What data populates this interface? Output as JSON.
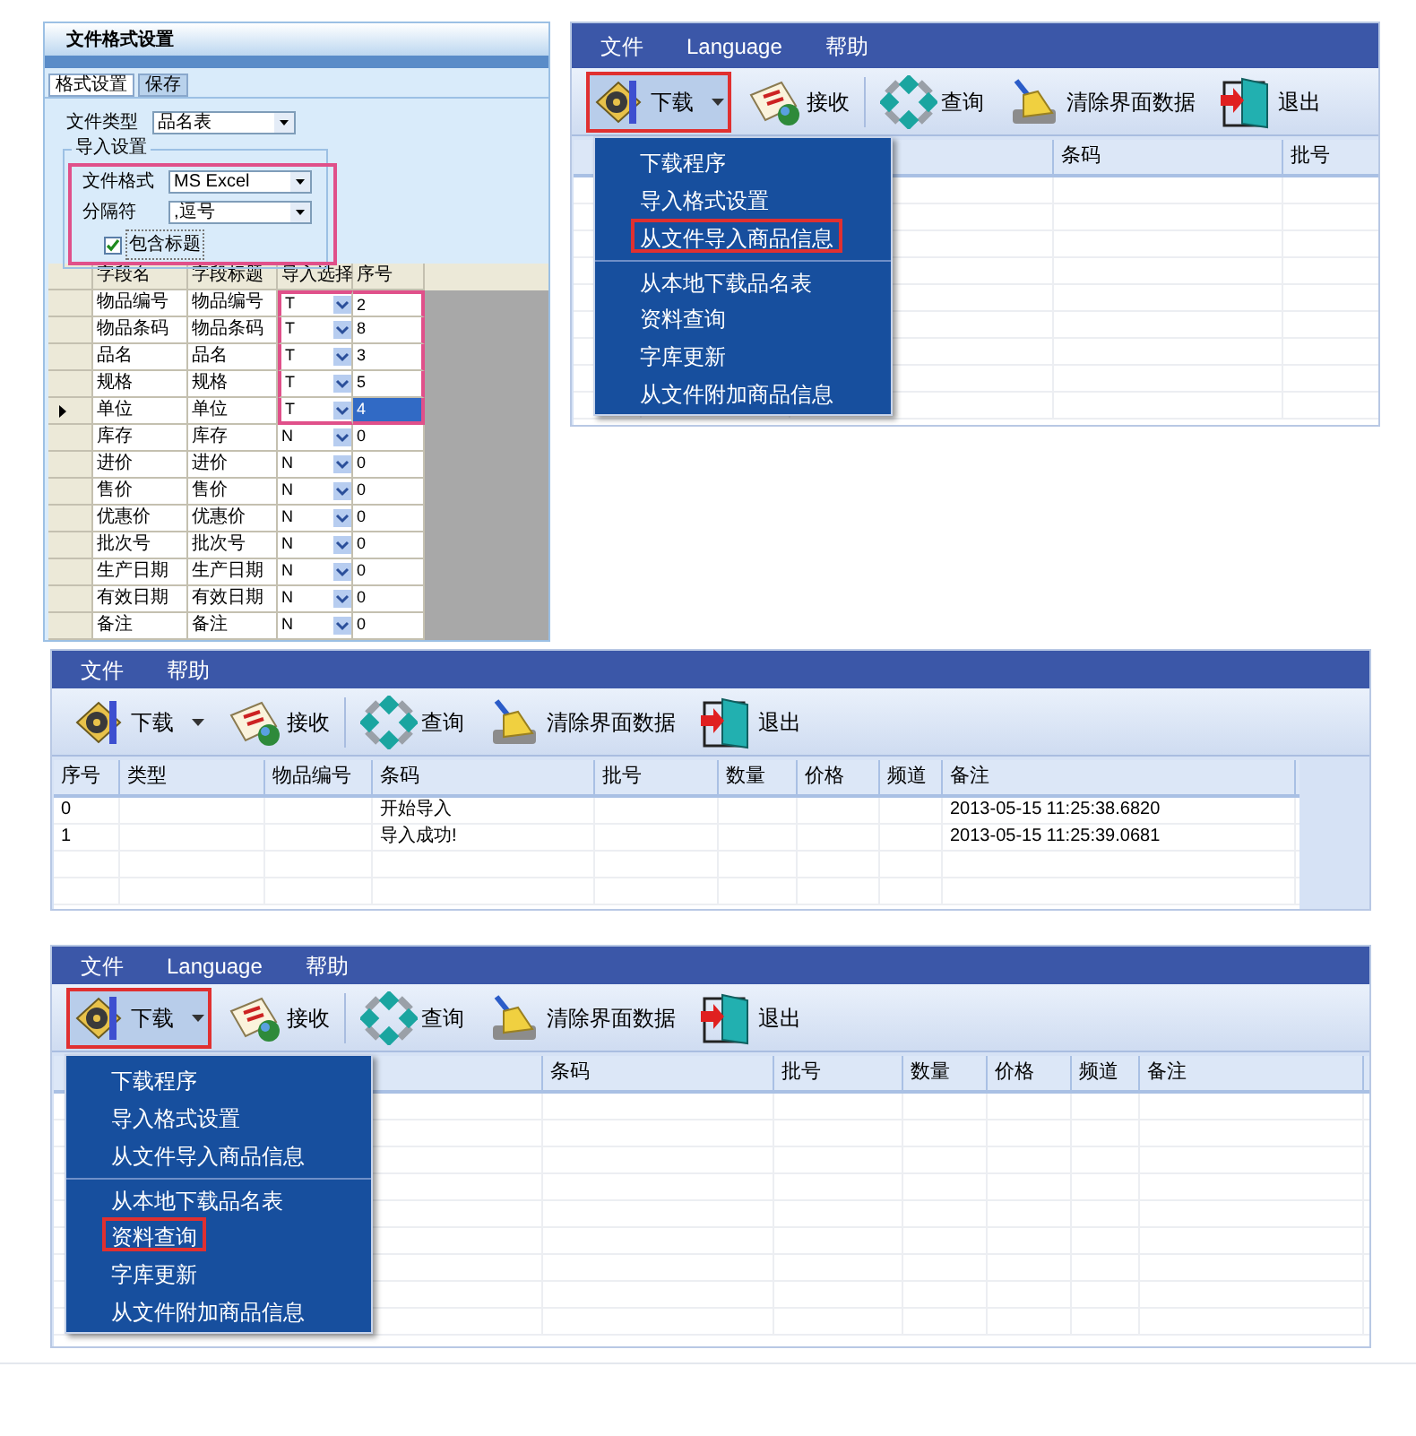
{
  "format_panel": {
    "title": "文件格式设置",
    "tabs": [
      {
        "label": "格式设置",
        "selected": true
      },
      {
        "label": "保存",
        "selected": false
      }
    ],
    "file_type": {
      "label": "文件类型",
      "value": "品名表"
    },
    "import_group": {
      "title": "导入设置",
      "highlighted": true,
      "fields": [
        {
          "label": "文件格式",
          "value": "MS Excel"
        },
        {
          "label": "分隔符",
          "value": ",逗号"
        }
      ],
      "include_header": {
        "label": "包含标题",
        "checked": true
      }
    },
    "grid": {
      "columns": [
        "字段名",
        "字段标题",
        "导入选择",
        "序号"
      ],
      "rows": [
        {
          "field": "物品编号",
          "caption": "物品编号",
          "import": "T",
          "order": "2",
          "current": false,
          "marked": true
        },
        {
          "field": "物品条码",
          "caption": "物品条码",
          "import": "T",
          "order": "8",
          "current": false,
          "marked": true
        },
        {
          "field": "品名",
          "caption": "品名",
          "import": "T",
          "order": "3",
          "current": false,
          "marked": true
        },
        {
          "field": "规格",
          "caption": "规格",
          "import": "T",
          "order": "5",
          "current": false,
          "marked": true
        },
        {
          "field": "单位",
          "caption": "单位",
          "import": "T",
          "order": "4",
          "current": true,
          "marked": true
        },
        {
          "field": "库存",
          "caption": "库存",
          "import": "N",
          "order": "0",
          "current": false,
          "marked": false
        },
        {
          "field": "进价",
          "caption": "进价",
          "import": "N",
          "order": "0",
          "current": false,
          "marked": false
        },
        {
          "field": "售价",
          "caption": "售价",
          "import": "N",
          "order": "0",
          "current": false,
          "marked": false
        },
        {
          "field": "优惠价",
          "caption": "优惠价",
          "import": "N",
          "order": "0",
          "current": false,
          "marked": false
        },
        {
          "field": "批次号",
          "caption": "批次号",
          "import": "N",
          "order": "0",
          "current": false,
          "marked": false
        },
        {
          "field": "生产日期",
          "caption": "生产日期",
          "import": "N",
          "order": "0",
          "current": false,
          "marked": false
        },
        {
          "field": "有效日期",
          "caption": "有效日期",
          "import": "N",
          "order": "0",
          "current": false,
          "marked": false
        },
        {
          "field": "备注",
          "caption": "备注",
          "import": "N",
          "order": "0",
          "current": false,
          "marked": false
        }
      ]
    }
  },
  "windows": [
    {
      "menu": [
        "文件",
        "Language",
        "帮助"
      ],
      "toolbar": [
        {
          "kind": "download",
          "label": "下载",
          "dropdown": true,
          "highlighted": true
        },
        {
          "kind": "receive",
          "label": "接收",
          "dropdown": false,
          "highlighted": false
        },
        {
          "kind": "query",
          "label": "查询",
          "dropdown": false,
          "highlighted": false
        },
        {
          "kind": "clear",
          "label": "清除界面数据",
          "dropdown": false,
          "highlighted": false
        },
        {
          "kind": "exit",
          "label": "退出",
          "dropdown": false,
          "highlighted": false
        }
      ],
      "table": {
        "columns": [
          "条码",
          "批号"
        ]
      },
      "popup": {
        "items": [
          {
            "label": "下载程序",
            "highlighted": false,
            "separator_before": false
          },
          {
            "label": "导入格式设置",
            "highlighted": false,
            "separator_before": false
          },
          {
            "label": "从文件导入商品信息",
            "highlighted": true,
            "separator_before": false
          },
          {
            "label": "从本地下载品名表",
            "highlighted": false,
            "separator_before": true
          },
          {
            "label": "资料查询",
            "highlighted": false,
            "separator_before": false
          },
          {
            "label": "字库更新",
            "highlighted": false,
            "separator_before": false
          },
          {
            "label": "从文件附加商品信息",
            "highlighted": false,
            "separator_before": false
          }
        ]
      }
    },
    {
      "menu": [
        "文件",
        "帮助"
      ],
      "toolbar": [
        {
          "kind": "download",
          "label": "下载",
          "dropdown": true,
          "highlighted": false
        },
        {
          "kind": "receive",
          "label": "接收",
          "dropdown": false,
          "highlighted": false
        },
        {
          "kind": "query",
          "label": "查询",
          "dropdown": false,
          "highlighted": false
        },
        {
          "kind": "clear",
          "label": "清除界面数据",
          "dropdown": false,
          "highlighted": false
        },
        {
          "kind": "exit",
          "label": "退出",
          "dropdown": false,
          "highlighted": false
        }
      ],
      "table": {
        "columns": [
          "序号",
          "类型",
          "物品编号",
          "条码",
          "批号",
          "数量",
          "价格",
          "频道",
          "备注"
        ],
        "rows": [
          {
            "no": "0",
            "barcode": "开始导入",
            "note": "2013-05-15 11:25:38.6820"
          },
          {
            "no": "1",
            "barcode": "导入成功!",
            "note": "2013-05-15 11:25:39.0681"
          }
        ]
      }
    },
    {
      "menu": [
        "文件",
        "Language",
        "帮助"
      ],
      "toolbar": [
        {
          "kind": "download",
          "label": "下载",
          "dropdown": true,
          "highlighted": true
        },
        {
          "kind": "receive",
          "label": "接收",
          "dropdown": false,
          "highlighted": false
        },
        {
          "kind": "query",
          "label": "查询",
          "dropdown": false,
          "highlighted": false
        },
        {
          "kind": "clear",
          "label": "清除界面数据",
          "dropdown": false,
          "highlighted": false
        },
        {
          "kind": "exit",
          "label": "退出",
          "dropdown": false,
          "highlighted": false
        }
      ],
      "table": {
        "columns": [
          "条码",
          "批号",
          "数量",
          "价格",
          "频道",
          "备注"
        ]
      },
      "popup": {
        "items": [
          {
            "label": "下载程序",
            "highlighted": false,
            "separator_before": false
          },
          {
            "label": "导入格式设置",
            "highlighted": false,
            "separator_before": false
          },
          {
            "label": "从文件导入商品信息",
            "highlighted": false,
            "separator_before": false
          },
          {
            "label": "从本地下载品名表",
            "highlighted": false,
            "separator_before": true
          },
          {
            "label": "资料查询",
            "highlighted": true,
            "separator_before": false
          },
          {
            "label": "字库更新",
            "highlighted": false,
            "separator_before": false
          },
          {
            "label": "从文件附加商品信息",
            "highlighted": false,
            "separator_before": false
          }
        ]
      }
    }
  ]
}
